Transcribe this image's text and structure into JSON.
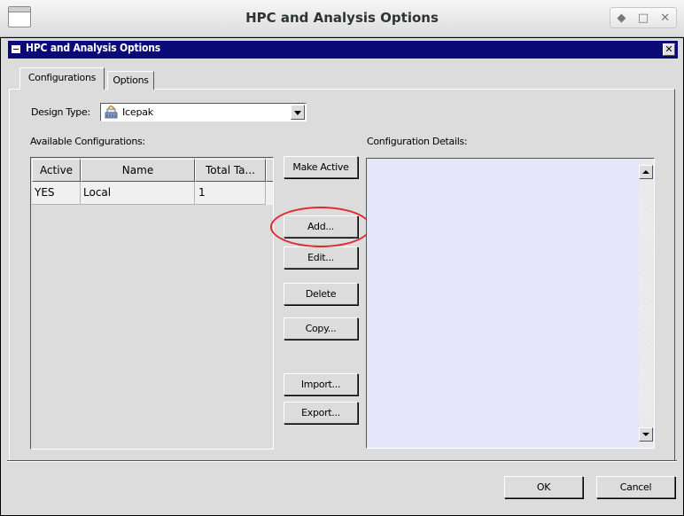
{
  "window": {
    "title": "HPC and Analysis Options",
    "controls": [
      "◆",
      "□",
      "✕"
    ]
  },
  "dialog": {
    "title": "HPC and Analysis Options",
    "close_label": "✕"
  },
  "tabs": [
    {
      "label": "Configurations",
      "active": true
    },
    {
      "label": "Options",
      "active": false
    }
  ],
  "design_type": {
    "label": "Design Type:",
    "value": "Icepak",
    "icon": "icepak-icon"
  },
  "available_configurations": {
    "label": "Available Configurations:",
    "columns": [
      "Active",
      "Name",
      "Total Ta..."
    ],
    "rows": [
      {
        "active": "YES",
        "name": "Local",
        "total": "1"
      }
    ]
  },
  "buttons": {
    "make_active": "Make Active",
    "add": "Add...",
    "edit": "Edit...",
    "delete": "Delete",
    "copy": "Copy...",
    "import": "Import...",
    "export": "Export..."
  },
  "configuration_details": {
    "label": "Configuration Details:"
  },
  "footer": {
    "ok": "OK",
    "cancel": "Cancel"
  },
  "colors": {
    "dialog_title_bg": "#0a0a78",
    "details_bg": "#e6e6fa",
    "highlight": "#e0282d"
  }
}
